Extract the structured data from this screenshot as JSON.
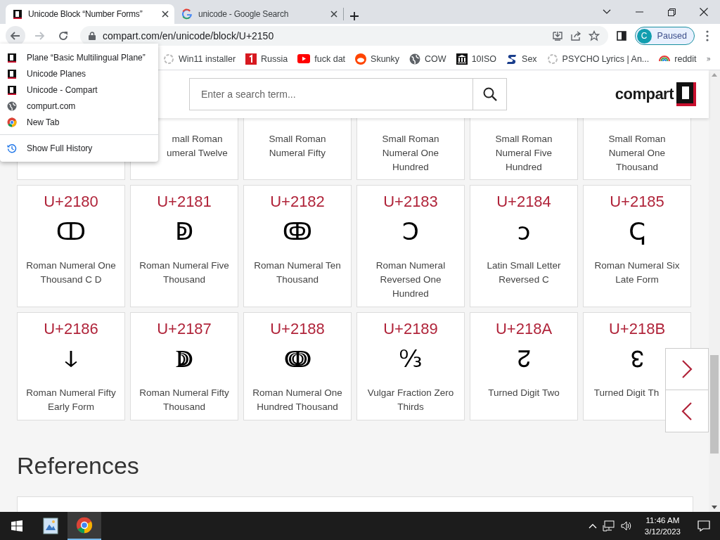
{
  "tabs": [
    {
      "title": "Unicode Block “Number Forms”",
      "kind": "compart",
      "selected": true
    },
    {
      "title": "unicode - Google Search",
      "kind": "google",
      "selected": false
    }
  ],
  "address": "compart.com/en/unicode/block/U+2150",
  "profile": {
    "initial": "C",
    "status": "Paused"
  },
  "bookmarks": [
    {
      "label": "Win11 installer",
      "kind": "ring"
    },
    {
      "label": "Russia",
      "kind": "redsquare"
    },
    {
      "label": "fuck dat",
      "kind": "youtube"
    },
    {
      "label": "Skunky",
      "kind": "reddit"
    },
    {
      "label": "COW",
      "kind": "globe"
    },
    {
      "label": "10ISO",
      "kind": "museum"
    },
    {
      "label": "Sex",
      "kind": "bluefont"
    },
    {
      "label": "PSYCHO Lyrics | An...",
      "kind": "ring"
    },
    {
      "label": "reddit",
      "kind": "rainbow"
    }
  ],
  "history_menu": {
    "items": [
      {
        "label": "Plane “Basic Multilingual Plane”",
        "kind": "compart"
      },
      {
        "label": "Unicode Planes",
        "kind": "compart"
      },
      {
        "label": "Unicode - Compart",
        "kind": "compart"
      },
      {
        "label": "compurt.com",
        "kind": "globe"
      },
      {
        "label": "New Tab",
        "kind": "chrome"
      }
    ],
    "footer": "Show Full History"
  },
  "page": {
    "search": {
      "placeholder": "Enter a search term..."
    },
    "logo": "compart",
    "partial_cards": [
      {
        "name": "mall Roman umeral Twelve"
      },
      {
        "name": "Small Roman Numeral Fifty"
      },
      {
        "name": "Small Roman Numeral One Hundred"
      },
      {
        "name": "Small Roman Numeral Five Hundred"
      },
      {
        "name": "Small Roman Numeral One Thousand"
      }
    ],
    "cards": [
      {
        "code": "U+2180",
        "glyph": "ↀ",
        "name": "Roman Numeral One Thousand C D"
      },
      {
        "code": "U+2181",
        "glyph": "ↁ",
        "name": "Roman Numeral Five Thousand"
      },
      {
        "code": "U+2182",
        "glyph": "ↂ",
        "name": "Roman Numeral Ten Thousand"
      },
      {
        "code": "U+2183",
        "glyph": "Ↄ",
        "name": "Roman Numeral Reversed One Hundred"
      },
      {
        "code": "U+2184",
        "glyph": "ↄ",
        "name": "Latin Small Letter Reversed C"
      },
      {
        "code": "U+2185",
        "glyph": "ↅ",
        "name": "Roman Numeral Six Late Form"
      },
      {
        "code": "U+2186",
        "glyph": "ↆ",
        "name": "Roman Numeral Fifty Early Form"
      },
      {
        "code": "U+2187",
        "glyph": "ↇ",
        "name": "Roman Numeral Fifty Thousand"
      },
      {
        "code": "U+2188",
        "glyph": "ↈ",
        "name": "Roman Numeral One Hundred Thousand"
      },
      {
        "code": "U+2189",
        "glyph": "↉",
        "name": "Vulgar Fraction Zero Thirds"
      },
      {
        "code": "U+218A",
        "glyph": "↊",
        "name": "Turned Digit Two"
      },
      {
        "code": "U+218B",
        "glyph": "↋",
        "name": "Turned Digit Th"
      }
    ],
    "heading": "References"
  },
  "taskbar": {
    "apps": [
      {
        "kind": "photos",
        "selected": false
      },
      {
        "kind": "chrome",
        "selected": true
      }
    ],
    "time": "11:46 AM",
    "date": "3/12/2023"
  }
}
